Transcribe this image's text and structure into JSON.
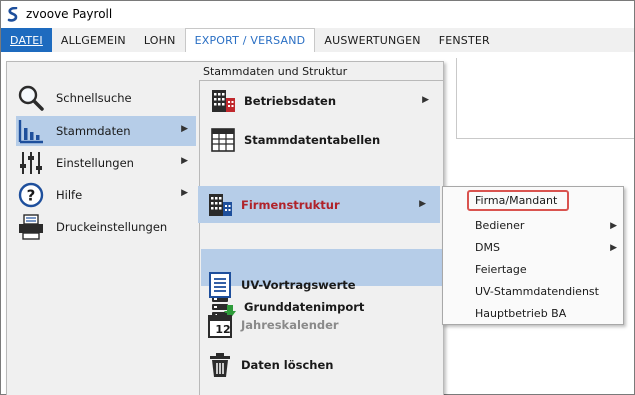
{
  "window": {
    "title": "zvoove Payroll",
    "logo_icon": "zvoove-logo"
  },
  "menubar": {
    "items": [
      {
        "label": "DATEI",
        "state": "open"
      },
      {
        "label": "ALLGEMEIN"
      },
      {
        "label": "LOHN"
      },
      {
        "label": "EXPORT / VERSAND",
        "state": "active"
      },
      {
        "label": "AUSWERTUNGEN"
      },
      {
        "label": "FENSTER"
      }
    ]
  },
  "file_menu": {
    "left_items": [
      {
        "label": "Schnellsuche",
        "icon": "magnifier-icon"
      },
      {
        "label": "Stammdaten",
        "icon": "bar-chart-icon",
        "selected": true,
        "submenu": true
      },
      {
        "label": "Einstellungen",
        "icon": "sliders-icon",
        "submenu": true
      },
      {
        "label": "Hilfe",
        "icon": "help-icon",
        "submenu": true
      },
      {
        "label": "Druckeinstellungen",
        "icon": "printer-icon"
      }
    ],
    "right_header": "Stammdaten und Struktur",
    "right_items": [
      {
        "label": "Betriebsdaten",
        "icon": "building-red-icon",
        "submenu": true
      },
      {
        "label": "Stammdatentabellen",
        "icon": "table-icon"
      },
      {
        "label": "Firmenstruktur",
        "icon": "building-structure-icon",
        "selected": true,
        "submenu": true
      },
      {
        "label": "Grunddatenimport",
        "icon": "database-import-icon"
      },
      {
        "label": "UV-Vortragswerte",
        "icon": "document-lines-icon"
      },
      {
        "label": "Jahreskalender",
        "icon": "calendar-icon",
        "disabled": true,
        "calendar_day": "12"
      },
      {
        "label": "Daten löschen",
        "icon": "trash-icon"
      }
    ]
  },
  "submenu": {
    "items": [
      {
        "label": "Firma/Mandant",
        "highlighted": true
      },
      {
        "label": "Bediener",
        "submenu": true
      },
      {
        "label": "DMS",
        "submenu": true
      },
      {
        "label": "Feiertage"
      },
      {
        "label": "UV-Stammdatendienst"
      },
      {
        "label": "Hauptbetrieb BA"
      }
    ]
  },
  "colors": {
    "accent": "#1e6bbf",
    "selection": "#b6cde8",
    "highlight_outline": "#d9534f"
  }
}
